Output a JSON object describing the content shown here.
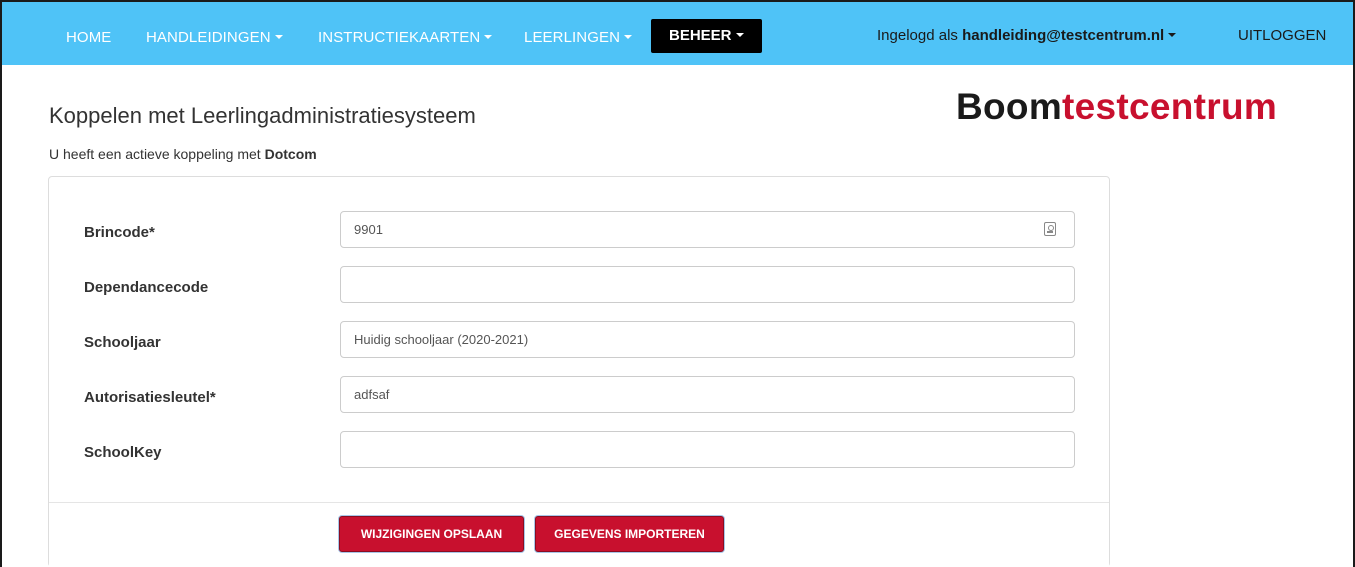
{
  "nav": {
    "home": "HOME",
    "handleidingen": "HANDLEIDINGEN",
    "instructiekaarten": "INSTRUCTIEKAARTEN",
    "leerlingen": "LEERLINGEN",
    "beheer": "BEHEER",
    "user_prefix": "Ingelogd als",
    "user_email": "handleiding@testcentrum.nl",
    "logout": "UITLOGGEN"
  },
  "page": {
    "title": "Koppelen met Leerlingadministratiesysteem",
    "subtitle_prefix": "U heeft een actieve koppeling met",
    "subtitle_system": "Dotcom"
  },
  "logo": {
    "part1": "Boom",
    "part2": "testcentrum"
  },
  "form": {
    "fields": [
      {
        "label": "Brincode*",
        "value": "9901",
        "placeholder": ""
      },
      {
        "label": "Dependancecode",
        "value": "",
        "placeholder": ""
      },
      {
        "label": "Schooljaar",
        "value": "",
        "placeholder": "Huidig schooljaar (2020-2021)"
      },
      {
        "label": "Autorisatiesleutel*",
        "value": "adfsaf",
        "placeholder": ""
      },
      {
        "label": "SchoolKey",
        "value": "",
        "placeholder": ""
      }
    ],
    "save_button": "WIJZIGINGEN OPSLAAN",
    "import_button": "GEGEVENS IMPORTEREN"
  },
  "colors": {
    "navbar": "#4fc3f7",
    "nav_active": "#000000",
    "brand_red": "#c8102e"
  }
}
